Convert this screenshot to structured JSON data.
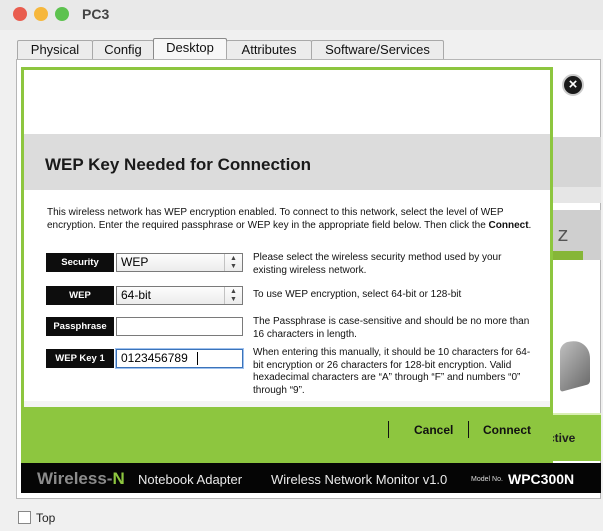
{
  "window": {
    "title": "PC3"
  },
  "tabs": [
    {
      "label": "Physical"
    },
    {
      "label": "Config"
    },
    {
      "label": "Desktop"
    },
    {
      "label": "Attributes"
    },
    {
      "label": "Software/Services"
    }
  ],
  "background_app": {
    "close_glyph": "×",
    "partial_text": "z",
    "status_partial": "ctive"
  },
  "adapter_bar": {
    "brand_a": "Wireless-",
    "brand_b": "N",
    "product": "Notebook Adapter",
    "monitor": "Wireless Network Monitor  v1.0",
    "model_label": "Model No.",
    "model": "WPC300N"
  },
  "dialog": {
    "title": "WEP Key Needed for Connection",
    "intro": "This wireless network has WEP encryption enabled. To connect to this network, select the level of WEP encryption. Enter the required passphrase or WEP key in the appropriate field below. Then click the ",
    "intro_bold": "Connect",
    "intro_end": ".",
    "fields": {
      "security": {
        "label": "Security",
        "value": "WEP",
        "desc": "Please select the wireless security method used by your existing wireless network."
      },
      "wep": {
        "label": "WEP",
        "value": "64-bit",
        "desc": "To use WEP encryption, select 64-bit or 128-bit"
      },
      "passphrase": {
        "label": "Passphrase",
        "value": "",
        "desc": "The Passphrase is case-sensitive and should be no more than 16 characters in length."
      },
      "wepkey1": {
        "label": "WEP Key 1",
        "value": "0123456789",
        "desc": "When entering this manually, it should be 10 characters for 64-bit encryption or 26 characters for 128-bit encryption. Valid hexadecimal characters are “A” through “F” and numbers “0”  through “9”."
      }
    },
    "buttons": {
      "cancel": "Cancel",
      "connect": "Connect"
    }
  },
  "footer": {
    "top_label": "Top"
  },
  "colors": {
    "accent_green": "#8dc63f",
    "header_gray": "#dcdcdc",
    "label_black": "#0d0d0d"
  },
  "icons": [
    "close-icon",
    "dropdown-arrow-icon"
  ]
}
